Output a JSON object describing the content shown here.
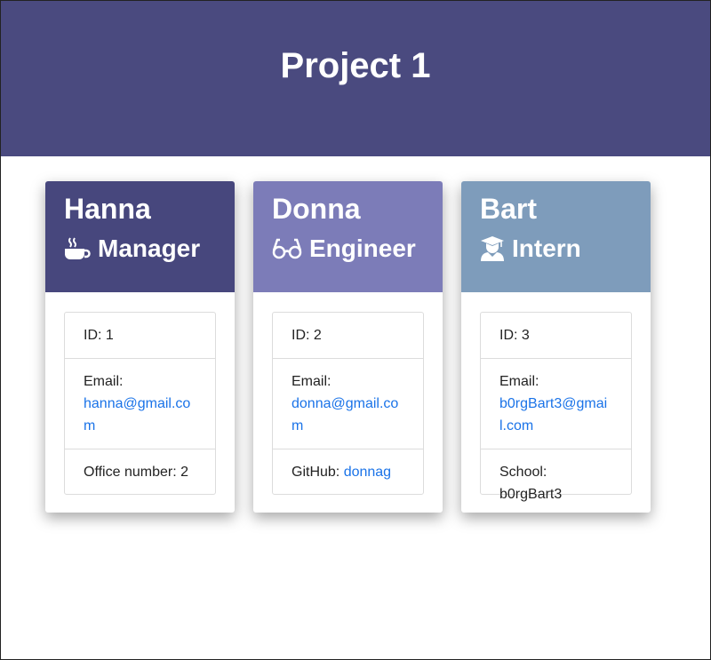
{
  "header": {
    "title": "Project 1"
  },
  "cards": [
    {
      "name": "Hanna",
      "role": "Manager",
      "role_icon": "coffee-icon",
      "header_color": "#47477d",
      "id_label": "ID: 1",
      "email_label": "Email:",
      "email": "hanna@gmail.com",
      "extra_label": "Office number: 2",
      "extra_value": ""
    },
    {
      "name": "Donna",
      "role": "Engineer",
      "role_icon": "glasses-icon",
      "header_color": "#7c7cb8",
      "id_label": "ID: 2",
      "email_label": "Email:",
      "email": "donna@gmail.com",
      "extra_label": "GitHub: ",
      "extra_value": "donnag"
    },
    {
      "name": "Bart",
      "role": "Intern",
      "role_icon": "graduate-icon",
      "header_color": "#7e9cbb",
      "id_label": "ID: 3",
      "email_label": "Email:",
      "email": "b0rgBart3@gmail.com",
      "extra_label": "School: b0rgBart3",
      "extra_value": ""
    }
  ]
}
